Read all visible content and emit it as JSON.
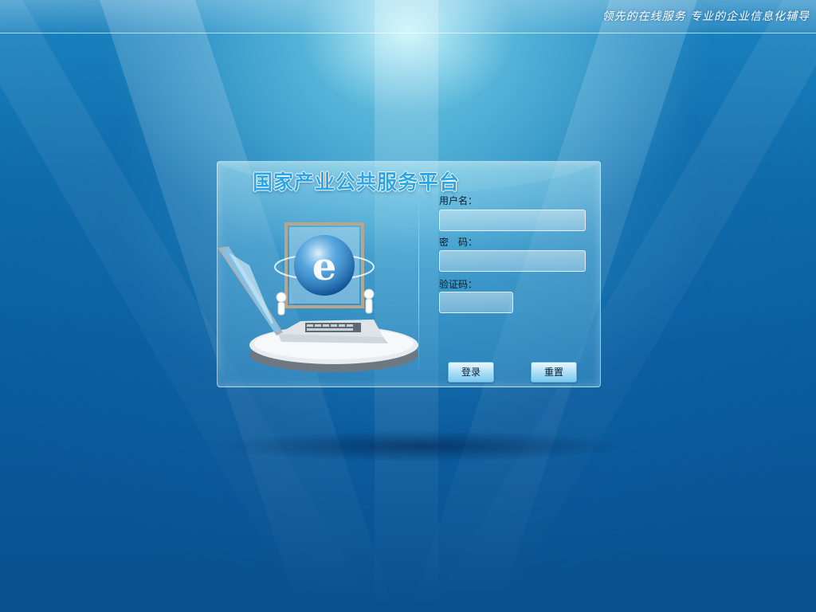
{
  "header": {
    "slogan": "领先的在线服务 专业的企业信息化辅导"
  },
  "login": {
    "title": "国家产业公共服务平台",
    "username_label": "用户名：",
    "username_value": "",
    "password_label": "密　码：",
    "password_value": "",
    "captcha_label": "验证码：",
    "captcha_value": "",
    "login_button": "登录",
    "reset_button": "重置"
  },
  "colors": {
    "background": "#0a5c9e",
    "title": "#2aa6e6",
    "button_top": "#eaf8ff",
    "button_bottom": "#7fc8ee"
  },
  "icons": {
    "illustration": "laptop-with-globe-icon"
  }
}
